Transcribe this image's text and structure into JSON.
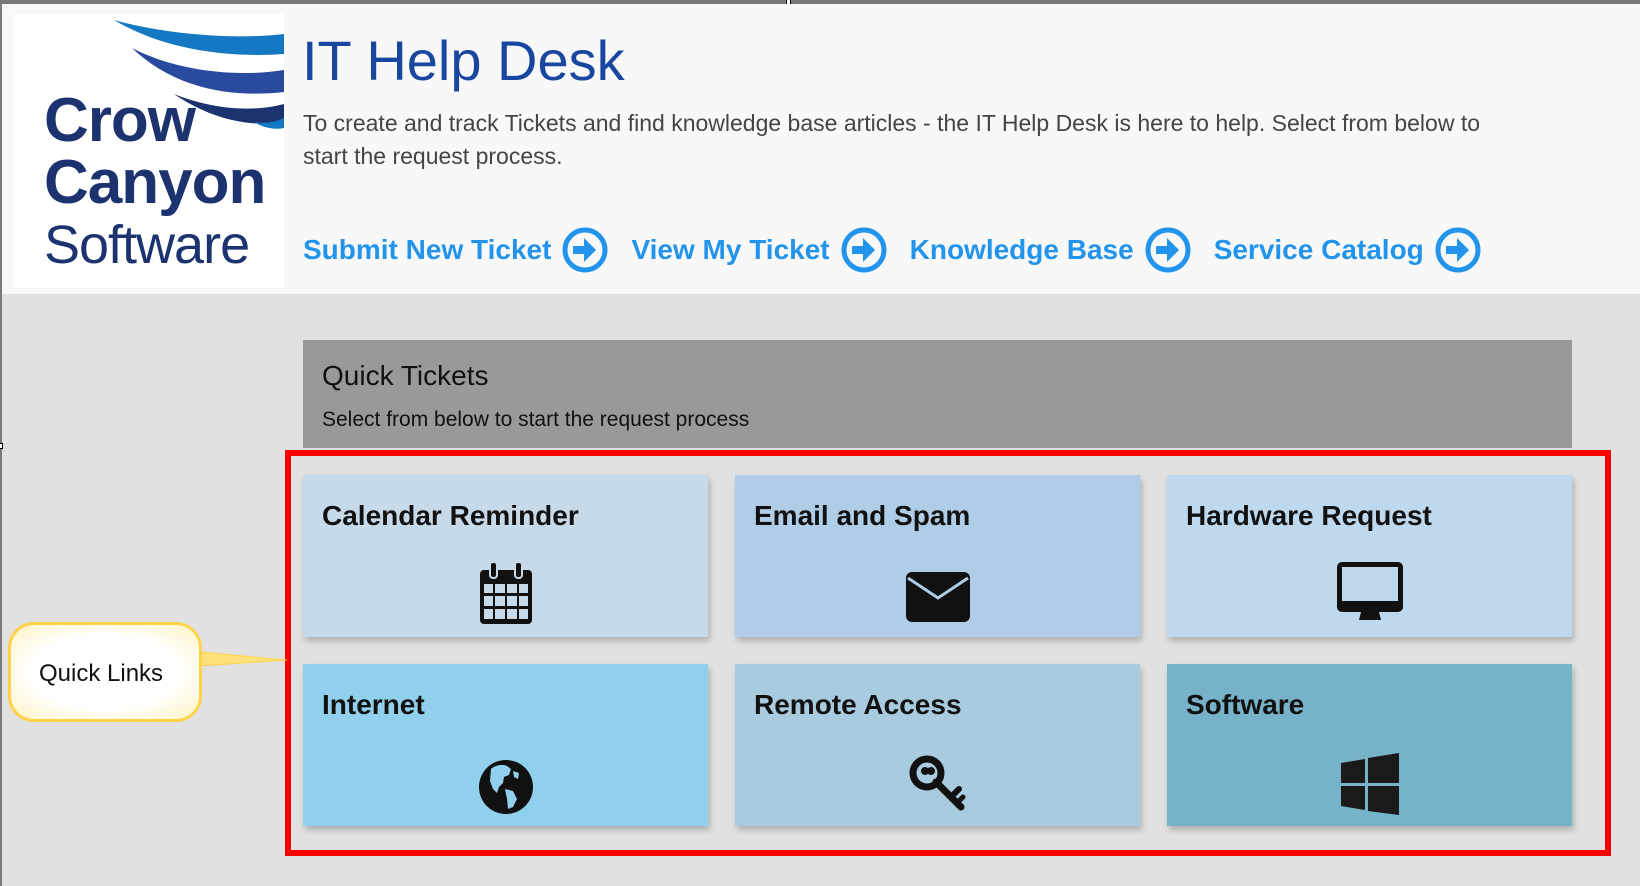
{
  "logo": {
    "line1": "Crow",
    "line2": "Canyon",
    "line3": "Software",
    "colors": {
      "text": "#1c3370",
      "wave1": "#1479c2",
      "wave2": "#2a4aa0",
      "wave3": "#1c3370"
    }
  },
  "header": {
    "title": "IT Help Desk",
    "description": "To create and track Tickets and find knowledge base articles - the IT Help Desk is here to help. Select from below to start the request process.",
    "title_color": "#1947a0"
  },
  "nav": {
    "accent": "#2394ec",
    "links": [
      {
        "label": "Submit New Ticket",
        "icon": "arrow-circle-right-icon"
      },
      {
        "label": "View My Ticket",
        "icon": "arrow-circle-right-icon"
      },
      {
        "label": "Knowledge Base",
        "icon": "arrow-circle-right-icon"
      },
      {
        "label": "Service Catalog",
        "icon": "arrow-circle-right-icon"
      }
    ]
  },
  "quick_tickets": {
    "title": "Quick Tickets",
    "subtitle": "Select from below to start the request process",
    "tiles": [
      {
        "label": "Calendar Reminder",
        "icon": "calendar-icon",
        "color": "#c7daea"
      },
      {
        "label": "Email and Spam",
        "icon": "envelope-icon",
        "color": "#afcde7"
      },
      {
        "label": "Hardware Request",
        "icon": "monitor-icon",
        "color": "#bed8ee"
      },
      {
        "label": "Internet",
        "icon": "globe-icon",
        "color": "#90d0ec"
      },
      {
        "label": "Remote Access",
        "icon": "key-icon",
        "color": "#a8cbe0"
      },
      {
        "label": "Software",
        "icon": "windows-icon",
        "color": "#76b2c8"
      }
    ]
  },
  "annotation": {
    "callout_text": "Quick Links",
    "highlight_color": "#ff0000",
    "callout_border": "#ffd24a"
  }
}
